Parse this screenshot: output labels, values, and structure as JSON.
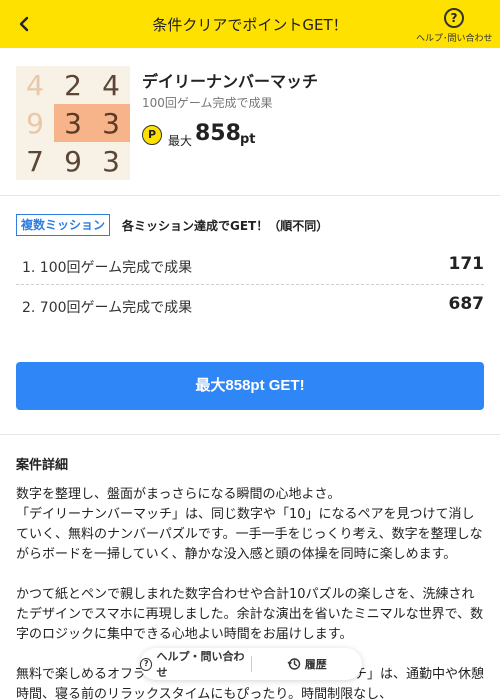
{
  "header": {
    "title": "条件クリアでポイントGET！",
    "back_icon": "chevron-left-icon",
    "help_label": "ヘルプ･問い合わせ",
    "help_icon": "question-circle-icon",
    "background": "#ffe100"
  },
  "product": {
    "title": "デイリーナンバーマッチ",
    "subtitle": "100回ゲーム完成で成果",
    "coin_symbol": "P",
    "max_prefix": "最大",
    "max_points": "858",
    "unit": "pt",
    "puzzle": [
      [
        "4",
        "2",
        "4"
      ],
      [
        "9",
        "3",
        "3"
      ],
      [
        "7",
        "9",
        "3"
      ]
    ]
  },
  "missions": {
    "tag": "複数ミッション",
    "note": "各ミッション達成でGET！（順不同）",
    "items": [
      {
        "label": "1. 100回ゲーム完成で成果",
        "points": "171"
      },
      {
        "label": "2. 700回ゲーム完成で成果",
        "points": "687"
      }
    ]
  },
  "cta": {
    "label": "最大858pt GET!",
    "color": "#2f86f6"
  },
  "details": {
    "title": "案件詳細",
    "paragraphs": [
      "数字を整理し、盤面がまっさらになる瞬間の心地よさ。\n「デイリーナンバーマッチ」は、同じ数字や「10」になるペアを見つけて消していく、無料のナンバーパズルです。一手一手をじっくり考え、数字を整理しながらボードを一掃していく、静かな没入感と頭の体操を同時に楽しめます。",
      "かつて紙とペンで親しまれた数字合わせや合計10パズルの楽しさを、洗練されたデザインでスマホに再現しました。余計な演出を省いたミニマルな世界で、数字のロジックに集中できる心地よい時間をお届けします。",
      "無料で楽しめるオフライン対応の「デイリーナンバーマッチ」は、通勤中や休憩時間、寝る前のリラックスタイムにもぴったり。時間制限なし、"
    ]
  },
  "bottom_bar": {
    "help_label": "ヘルプ・問い合わせ",
    "history_label": "履歴",
    "help_icon": "question-circle-icon",
    "history_icon": "history-icon"
  }
}
